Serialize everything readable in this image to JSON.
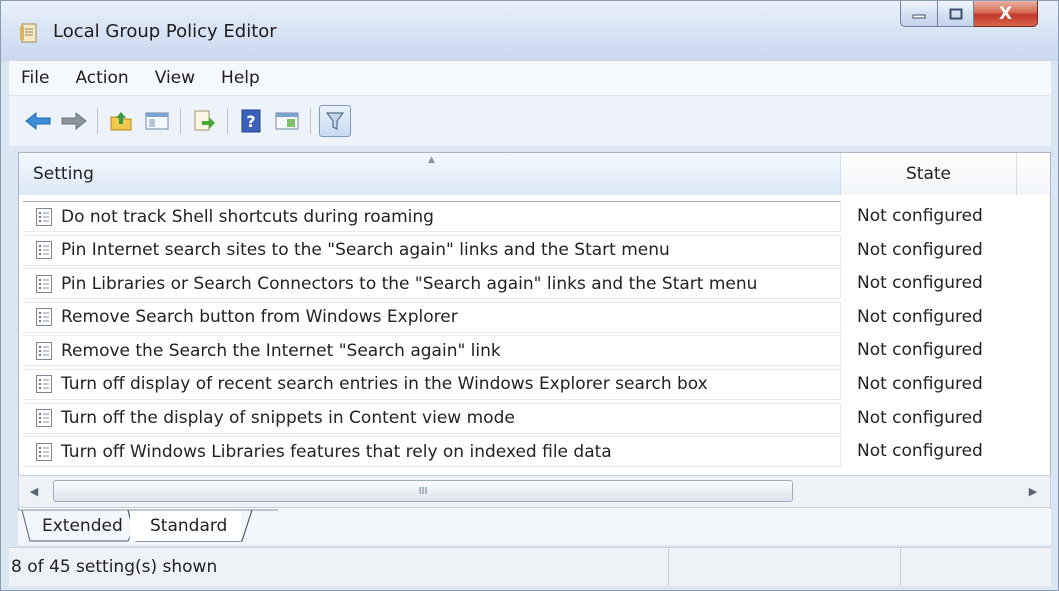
{
  "window": {
    "title": "Local Group Policy Editor",
    "close_glyph": "X",
    "icons": {
      "app": "policy-editor-icon",
      "minimize": "minimize-icon",
      "maximize": "maximize-icon",
      "close": "close-icon"
    }
  },
  "menu": {
    "items": [
      "File",
      "Action",
      "View",
      "Help"
    ]
  },
  "toolbar": {
    "buttons": [
      "back-arrow-icon",
      "forward-arrow-icon",
      "up-folder-icon",
      "show-hide-tree-icon",
      "export-list-icon",
      "help-icon",
      "properties-view-icon",
      "filter-icon"
    ]
  },
  "list": {
    "columns": {
      "setting": "Setting",
      "state": "State"
    },
    "rows": [
      {
        "setting": "Do not track Shell shortcuts during roaming",
        "state": "Not configured"
      },
      {
        "setting": "Pin Internet search sites to the \"Search again\" links and the Start menu",
        "state": "Not configured"
      },
      {
        "setting": "Pin Libraries or Search Connectors to the \"Search again\" links and the Start menu",
        "state": "Not configured"
      },
      {
        "setting": "Remove Search button from Windows Explorer",
        "state": "Not configured"
      },
      {
        "setting": "Remove the Search the Internet \"Search again\" link",
        "state": "Not configured"
      },
      {
        "setting": "Turn off display of recent search entries in the Windows Explorer search box",
        "state": "Not configured"
      },
      {
        "setting": "Turn off the display of snippets in Content view mode",
        "state": "Not configured"
      },
      {
        "setting": "Turn off Windows Libraries features that rely on indexed file data",
        "state": "Not configured"
      }
    ]
  },
  "scrollbar": {
    "grip": "III"
  },
  "tabs": {
    "extended": "Extended",
    "standard": "Standard",
    "active": "Standard"
  },
  "status": {
    "text": "8 of 45 setting(s) shown"
  },
  "colors": {
    "accent": "#3a78c8",
    "close": "#c0382a",
    "header_sorted": "#dbe9f7"
  }
}
